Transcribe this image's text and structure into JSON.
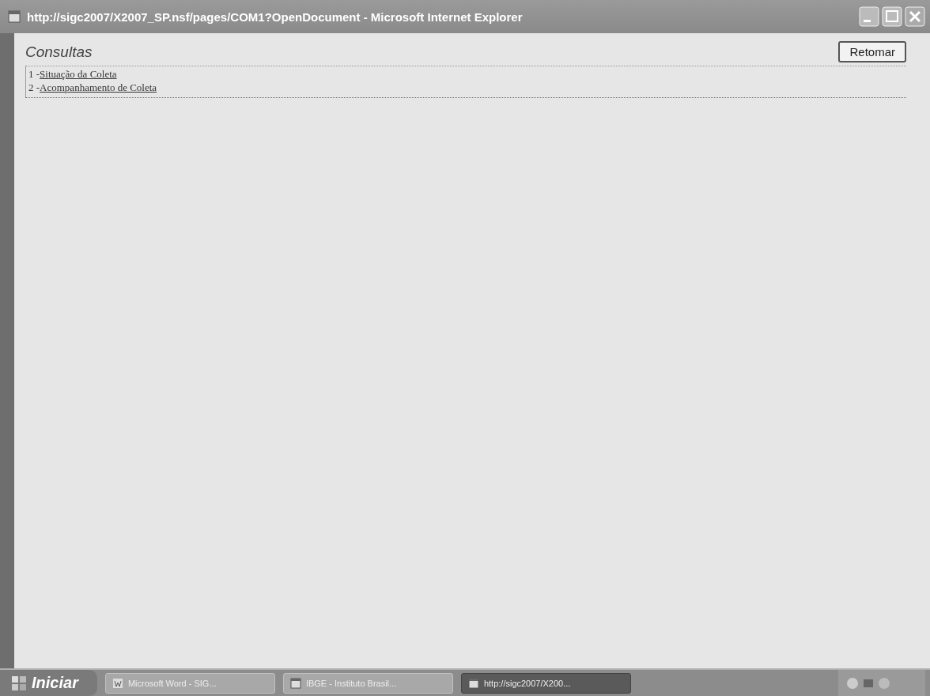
{
  "window": {
    "title": "http://sigc2007/X2007_SP.nsf/pages/COM1?OpenDocument - Microsoft Internet Explorer"
  },
  "page": {
    "heading": "Consultas",
    "button": "Retomar",
    "links": [
      {
        "number": "1 - ",
        "label": "Situação da Coleta"
      },
      {
        "number": "2 - ",
        "label": "Acompanhamento de Coleta"
      }
    ]
  },
  "taskbar": {
    "start": "Iniciar",
    "tasks": [
      {
        "label": "Microsoft Word - SIG...",
        "kind": "word",
        "selected": false
      },
      {
        "label": "IBGE - Instituto Brasil...",
        "kind": "browser",
        "selected": false
      },
      {
        "label": "http://sigc2007/X200...",
        "kind": "browser",
        "selected": true
      }
    ]
  }
}
